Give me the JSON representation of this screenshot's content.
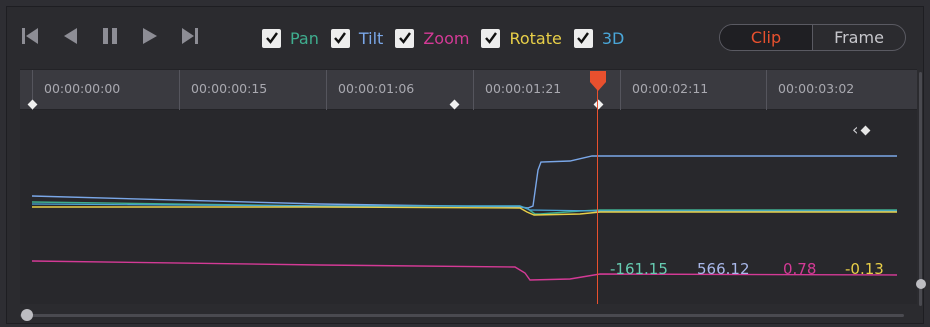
{
  "transport": {
    "icons": [
      "skip-start-icon",
      "step-back-icon",
      "pause-icon",
      "play-icon",
      "skip-end-icon"
    ]
  },
  "channels": [
    {
      "label": "Pan",
      "color": "#3fae8f",
      "checked": true
    },
    {
      "label": "Tilt",
      "color": "#7aa7e8",
      "checked": true
    },
    {
      "label": "Zoom",
      "color": "#d43a96",
      "checked": true
    },
    {
      "label": "Rotate",
      "color": "#e8cf48",
      "checked": true
    },
    {
      "label": "3D",
      "color": "#4aa6d8",
      "checked": true
    }
  ],
  "mode_toggle": {
    "clip": "Clip",
    "frame": "Frame",
    "active": "clip"
  },
  "ruler": {
    "ticks": [
      "00:00:00:00",
      "00:00:00:15",
      "00:00:01:06",
      "00:00:01:21",
      "00:00:02:11",
      "00:00:03:02"
    ],
    "playhead_timecode": "00:00:01:21"
  },
  "values": [
    {
      "text": "-161.15",
      "color": "#66cbb1"
    },
    {
      "text": "566.12",
      "color": "#a9b8ea"
    },
    {
      "text": "0.78",
      "color": "#d43a96"
    },
    {
      "text": "-0.13",
      "color": "#e8cf48"
    }
  ],
  "accent": "#e8502e"
}
